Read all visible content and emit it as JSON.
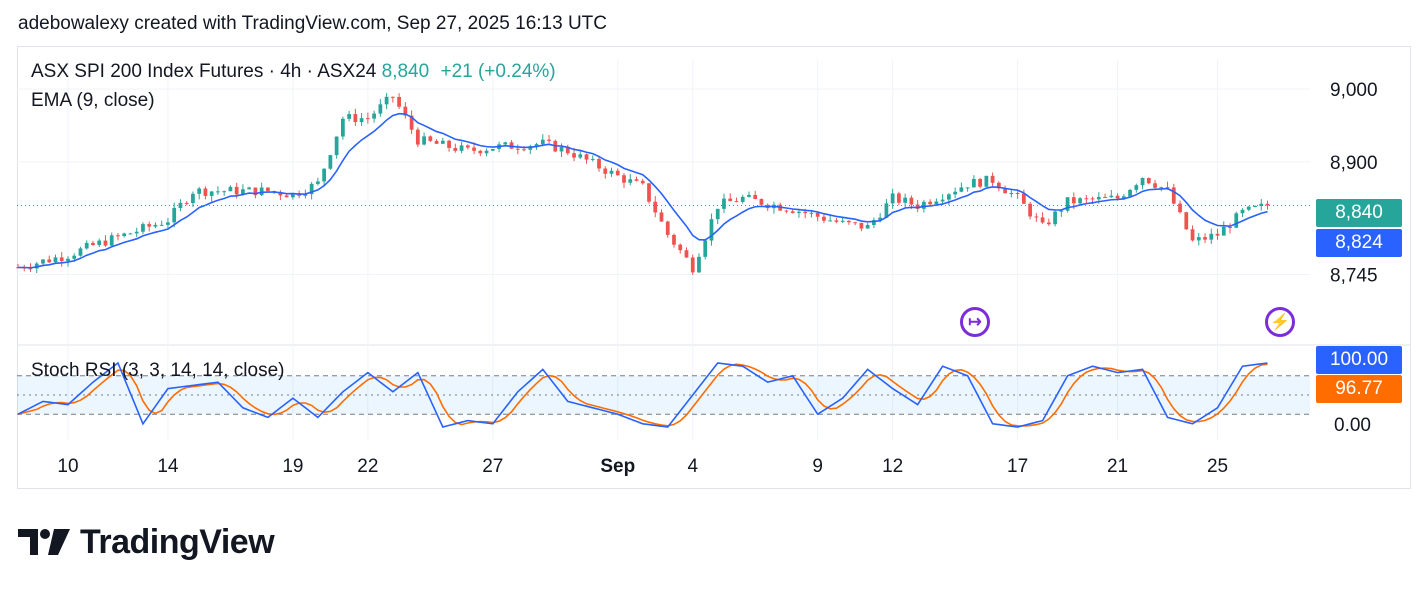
{
  "header": {
    "text": "adebowalexy created with TradingView.com, Sep 27, 2025 16:13 UTC"
  },
  "legend": {
    "symbol": "ASX SPI 200 Index Futures · 4h · ASX24",
    "price": "8,840",
    "change": "+21 (+0.24%)",
    "ema_label": "EMA (9, close)",
    "stoch_label": "Stoch RSI (3, 3, 14, 14, close)"
  },
  "badges": {
    "price": "8,840",
    "ema": "8,824",
    "k": "100.00",
    "d": "96.77"
  },
  "colors": {
    "up": "#26a69a",
    "down": "#ef5350",
    "ema": "#2962ff",
    "k": "#2962ff",
    "d": "#ff6d00",
    "band": "#2196f3",
    "icon": "#7b2cdb"
  },
  "logo": {
    "text": "TradingView"
  },
  "icons": [
    "arrow-right-circle-icon",
    "lightning-circle-icon"
  ],
  "chart_data": {
    "type": "candlestick",
    "title": "ASX SPI 200 Index Futures · 4h · ASX24",
    "x_tick_labels": [
      "10",
      "14",
      "19",
      "22",
      "27",
      "Sep",
      "4",
      "9",
      "12",
      "17",
      "21",
      "25"
    ],
    "price_axis": {
      "ticks": [
        9000,
        8900,
        8745
      ],
      "tick_labels": [
        "9,000",
        "8,900",
        "8,745"
      ],
      "range": [
        8655,
        9040
      ]
    },
    "last_price": 8840,
    "ema9_last": 8824,
    "price_anchors": [
      {
        "date": "Aug 8",
        "close": 8755
      },
      {
        "date": "Aug 10",
        "close": 8772
      },
      {
        "date": "Aug 11",
        "close": 8785
      },
      {
        "date": "Aug 13",
        "close": 8808
      },
      {
        "date": "Aug 14",
        "close": 8820
      },
      {
        "date": "Aug 15",
        "close": 8860
      },
      {
        "date": "Aug 18",
        "close": 8860
      },
      {
        "date": "Aug 19",
        "close": 8855
      },
      {
        "date": "Aug 20",
        "close": 8870
      },
      {
        "date": "Aug 21",
        "close": 8960
      },
      {
        "date": "Aug 22",
        "close": 8960
      },
      {
        "date": "Aug 23",
        "close": 8990
      },
      {
        "date": "Aug 24",
        "close": 8930
      },
      {
        "date": "Aug 26",
        "close": 8915
      },
      {
        "date": "Aug 27",
        "close": 8920
      },
      {
        "date": "Aug 29",
        "close": 8925
      },
      {
        "date": "Aug 30",
        "close": 8915
      },
      {
        "date": "Sep 1",
        "close": 8880
      },
      {
        "date": "Sep 2",
        "close": 8865
      },
      {
        "date": "Sep 3",
        "close": 8800
      },
      {
        "date": "Sep 4",
        "close": 8755
      },
      {
        "date": "Sep 5",
        "close": 8840
      },
      {
        "date": "Sep 6",
        "close": 8850
      },
      {
        "date": "Sep 8",
        "close": 8835
      },
      {
        "date": "Sep 10",
        "close": 8815
      },
      {
        "date": "Sep 11",
        "close": 8810
      },
      {
        "date": "Sep 12",
        "close": 8850
      },
      {
        "date": "Sep 13",
        "close": 8840
      },
      {
        "date": "Sep 15",
        "close": 8870
      },
      {
        "date": "Sep 16",
        "close": 8875
      },
      {
        "date": "Sep 17",
        "close": 8850
      },
      {
        "date": "Sep 18",
        "close": 8810
      },
      {
        "date": "Sep 19",
        "close": 8845
      },
      {
        "date": "Sep 21",
        "close": 8850
      },
      {
        "date": "Sep 22",
        "close": 8880
      },
      {
        "date": "Sep 23",
        "close": 8860
      },
      {
        "date": "Sep 24",
        "close": 8790
      },
      {
        "date": "Sep 25",
        "close": 8800
      },
      {
        "date": "Sep 26",
        "close": 8830
      },
      {
        "date": "Sep 27",
        "close": 8840
      }
    ],
    "stoch_rsi": {
      "params": "3, 3, 14, 14, close",
      "axis_ticks": [
        100.0,
        0.0
      ],
      "axis_tick_labels": [
        "100.00",
        "0.00"
      ],
      "band": [
        20,
        80
      ],
      "k_last": 100.0,
      "d_last": 96.77,
      "k_anchors": [
        {
          "date": "Aug 8",
          "value": 20
        },
        {
          "date": "Aug 9",
          "value": 40
        },
        {
          "date": "Aug 10",
          "value": 35
        },
        {
          "date": "Aug 11",
          "value": 70
        },
        {
          "date": "Aug 12",
          "value": 100
        },
        {
          "date": "Aug 13",
          "value": 5
        },
        {
          "date": "Aug 14",
          "value": 60
        },
        {
          "date": "Aug 16",
          "value": 70
        },
        {
          "date": "Aug 17",
          "value": 30
        },
        {
          "date": "Aug 18",
          "value": 15
        },
        {
          "date": "Aug 19",
          "value": 45
        },
        {
          "date": "Aug 20",
          "value": 15
        },
        {
          "date": "Aug 21",
          "value": 55
        },
        {
          "date": "Aug 22",
          "value": 85
        },
        {
          "date": "Aug 23",
          "value": 55
        },
        {
          "date": "Aug 24",
          "value": 85
        },
        {
          "date": "Aug 25",
          "value": 0
        },
        {
          "date": "Aug 26",
          "value": 10
        },
        {
          "date": "Aug 27",
          "value": 5
        },
        {
          "date": "Aug 28",
          "value": 55
        },
        {
          "date": "Aug 29",
          "value": 90
        },
        {
          "date": "Aug 30",
          "value": 40
        },
        {
          "date": "Sep 1",
          "value": 20
        },
        {
          "date": "Sep 2",
          "value": 5
        },
        {
          "date": "Sep 3",
          "value": 0
        },
        {
          "date": "Sep 4",
          "value": 50
        },
        {
          "date": "Sep 5",
          "value": 100
        },
        {
          "date": "Sep 6",
          "value": 95
        },
        {
          "date": "Sep 7",
          "value": 70
        },
        {
          "date": "Sep 8",
          "value": 80
        },
        {
          "date": "Sep 9",
          "value": 20
        },
        {
          "date": "Sep 10",
          "value": 45
        },
        {
          "date": "Sep 11",
          "value": 90
        },
        {
          "date": "Sep 12",
          "value": 60
        },
        {
          "date": "Sep 13",
          "value": 35
        },
        {
          "date": "Sep 14",
          "value": 95
        },
        {
          "date": "Sep 15",
          "value": 80
        },
        {
          "date": "Sep 16",
          "value": 5
        },
        {
          "date": "Sep 17",
          "value": 0
        },
        {
          "date": "Sep 18",
          "value": 10
        },
        {
          "date": "Sep 19",
          "value": 80
        },
        {
          "date": "Sep 20",
          "value": 95
        },
        {
          "date": "Sep 21",
          "value": 85
        },
        {
          "date": "Sep 22",
          "value": 90
        },
        {
          "date": "Sep 23",
          "value": 15
        },
        {
          "date": "Sep 24",
          "value": 5
        },
        {
          "date": "Sep 25",
          "value": 30
        },
        {
          "date": "Sep 26",
          "value": 95
        },
        {
          "date": "Sep 27",
          "value": 100
        }
      ]
    }
  }
}
